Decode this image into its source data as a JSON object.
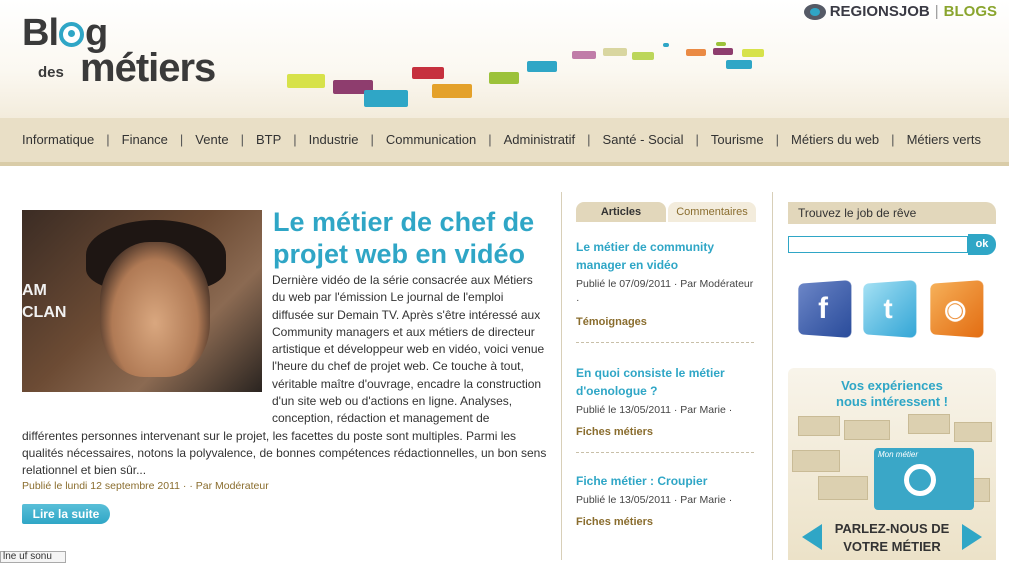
{
  "brand": {
    "logo_blog": "Blog",
    "logo_des": "des",
    "logo_metiers": "métiers",
    "regionsjob": "REGIONSJOB",
    "separator": "|",
    "blogs": "BLOGS"
  },
  "nav": {
    "items": [
      "Informatique",
      "Finance",
      "Vente",
      "BTP",
      "Industrie",
      "Communication",
      "Administratif",
      "Santé - Social",
      "Tourisme",
      "Métiers du web",
      "Métiers verts"
    ]
  },
  "article": {
    "title": "Le métier de chef de projet web en vidéo",
    "body": "Dernière vidéo de la série consacrée aux Métiers du web par l'émission Le journal de l'emploi diffusée sur Demain TV. Après s'être intéressé aux Community managers et aux métiers de directeur artistique et développeur web en vidéo, voici venue l'heure du chef de projet web. Ce touche à tout, véritable maître d'ouvrage, encadre la construction d'un site web ou d'actions en ligne. Analyses, conception, rédaction et management de différentes personnes intervenant sur le projet, les facettes du poste sont multiples. Parmi les qualités nécessaires, notons la polyvalence, de bonnes compétences rédactionnelles, un bon sens relationnel et bien sûr...",
    "meta": "Publié le lundi 12 septembre 2011 · · Par Modérateur",
    "read_more": "Lire la suite",
    "image_sign": "AM CLAN"
  },
  "sidebar_tabs": {
    "articles": "Articles",
    "comments": "Commentaires"
  },
  "sidebar_items": [
    {
      "title": "Le métier de community manager en vidéo",
      "meta": "Publié le 07/09/2011 · Par Modérateur ·",
      "category": "Témoignages"
    },
    {
      "title": "En quoi consiste le métier d'oenologue ?",
      "meta": "Publié le 13/05/2011 · Par Marie ·",
      "category": "Fiches métiers"
    },
    {
      "title": "Fiche métier : Croupier",
      "meta": "Publié le 13/05/2011 · Par Marie ·",
      "category": "Fiches métiers"
    }
  ],
  "job_search": {
    "heading": "Trouvez le job de rêve",
    "input_value": "",
    "ok_label": "ok"
  },
  "social": {
    "facebook_glyph": "f",
    "twitter_glyph": "t",
    "rss_glyph": "◉"
  },
  "promo": {
    "title_line1": "Vos expériences",
    "title_line2": "nous intéressent !",
    "screen_label": "Mon métier",
    "cta_line1": "PARLEZ-NOUS DE",
    "cta_line2": "VOTRE MÉTIER"
  },
  "status_fragment": "lne uf sonu",
  "colors": {
    "accent": "#2fa6c6",
    "nav_bg": "#e9dfc6",
    "meta_brown": "#8a6d2e",
    "brand_green": "#8aa52e"
  }
}
